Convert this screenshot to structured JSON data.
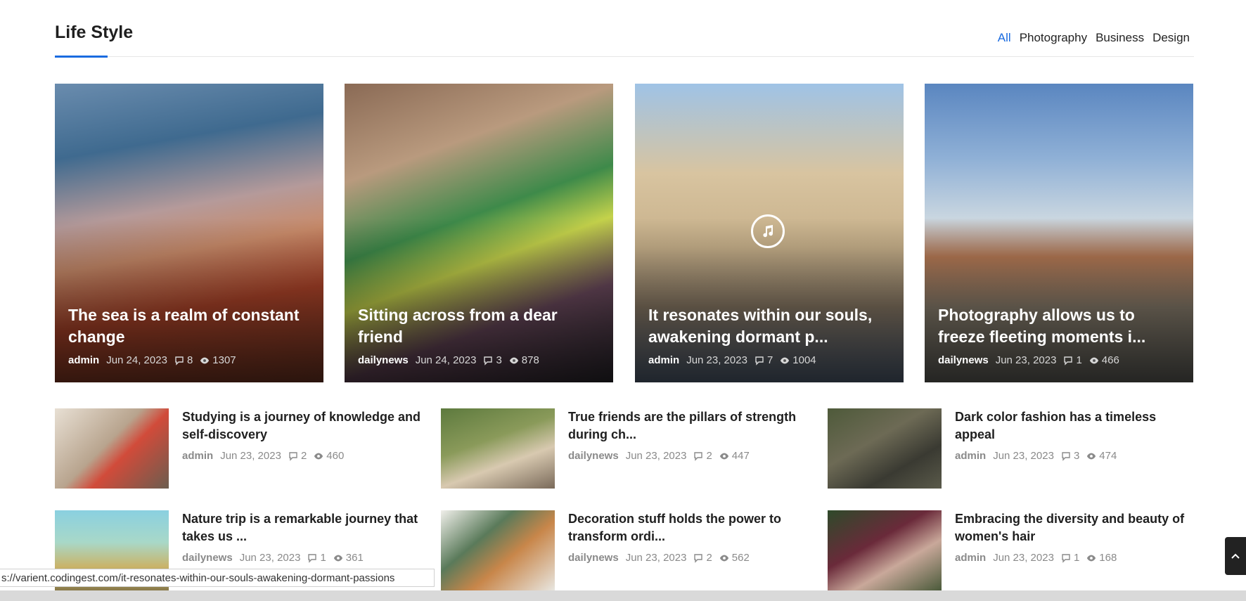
{
  "section": {
    "title": "Life Style",
    "tabs": [
      {
        "label": "All",
        "active": true
      },
      {
        "label": "Photography",
        "active": false
      },
      {
        "label": "Business",
        "active": false
      },
      {
        "label": "Design",
        "active": false
      }
    ]
  },
  "featured": [
    {
      "title": "The sea is a realm of constant change",
      "author": "admin",
      "date": "Jun 24, 2023",
      "comments": "8",
      "views": "1307",
      "image": "red-haired-woman-by-sea-photo"
    },
    {
      "title": "Sitting across from a dear friend",
      "author": "dailynews",
      "date": "Jun 24, 2023",
      "comments": "3",
      "views": "878",
      "image": "friends-at-cafe-photo"
    },
    {
      "title": "It resonates within our souls, awakening dormant p...",
      "author": "admin",
      "date": "Jun 23, 2023",
      "comments": "7",
      "views": "1004",
      "image": "woman-photographing-arches-photo",
      "has_audio_icon": true
    },
    {
      "title": "Photography allows us to freeze fleeting moments i...",
      "author": "dailynews",
      "date": "Jun 23, 2023",
      "comments": "1",
      "views": "466",
      "image": "woman-with-camera-lighthouse-photo"
    }
  ],
  "small_posts": [
    {
      "title": "Studying is a journey of knowledge and self-discovery",
      "author": "admin",
      "date": "Jun 23, 2023",
      "comments": "2",
      "views": "460"
    },
    {
      "title": "True friends are the pillars of strength during ch...",
      "author": "dailynews",
      "date": "Jun 23, 2023",
      "comments": "2",
      "views": "447"
    },
    {
      "title": "Dark color fashion has a timeless appeal",
      "author": "admin",
      "date": "Jun 23, 2023",
      "comments": "3",
      "views": "474"
    },
    {
      "title": "Nature trip is a remarkable journey that takes us ...",
      "author": "dailynews",
      "date": "Jun 23, 2023",
      "comments": "1",
      "views": "361"
    },
    {
      "title": "Decoration stuff holds the power to transform ordi...",
      "author": "dailynews",
      "date": "Jun 23, 2023",
      "comments": "2",
      "views": "562"
    },
    {
      "title": "Embracing the diversity and beauty of women's hair",
      "author": "admin",
      "date": "Jun 23, 2023",
      "comments": "1",
      "views": "168"
    }
  ],
  "status_bar": {
    "url": "s://varient.codingest.com/it-resonates-within-our-souls-awakening-dormant-passions"
  },
  "colors": {
    "accent": "#1a6be0",
    "title": "#1f1f1f",
    "meta": "#8a8a8a"
  }
}
